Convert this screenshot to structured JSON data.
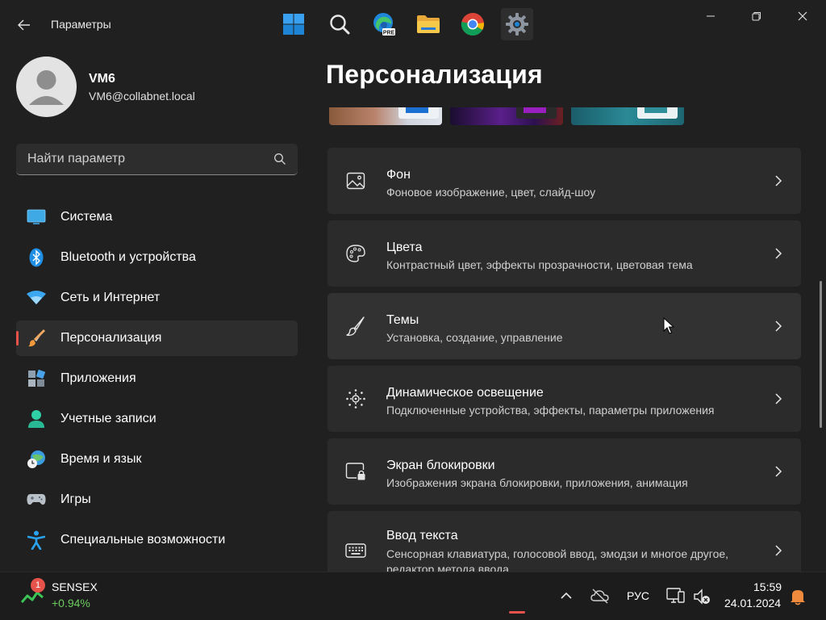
{
  "window": {
    "title": "Параметры",
    "colors": {
      "background": "#202020",
      "card": "#2b2b2b",
      "accent": "#e5534b"
    }
  },
  "profile": {
    "name": "VM6",
    "email": "VM6@collabnet.local"
  },
  "search": {
    "placeholder": "Найти параметр"
  },
  "sidebar": {
    "items": [
      {
        "label": "Система",
        "icon": "system-icon"
      },
      {
        "label": "Bluetooth и устройства",
        "icon": "bluetooth-icon"
      },
      {
        "label": "Сеть и Интернет",
        "icon": "wifi-icon"
      },
      {
        "label": "Персонализация",
        "icon": "brush-icon",
        "active": true
      },
      {
        "label": "Приложения",
        "icon": "apps-icon"
      },
      {
        "label": "Учетные записи",
        "icon": "account-icon"
      },
      {
        "label": "Время и язык",
        "icon": "time-language-icon"
      },
      {
        "label": "Игры",
        "icon": "gamepad-icon"
      },
      {
        "label": "Специальные возможности",
        "icon": "accessibility-icon"
      }
    ]
  },
  "main": {
    "title": "Персонализация",
    "cards": [
      {
        "title": "Фон",
        "subtitle": "Фоновое изображение, цвет, слайд-шоу",
        "icon": "image-icon"
      },
      {
        "title": "Цвета",
        "subtitle": "Контрастный цвет, эффекты прозрачности, цветовая тема",
        "icon": "palette-icon"
      },
      {
        "title": "Темы",
        "subtitle": "Установка, создание, управление",
        "icon": "brush-icon"
      },
      {
        "title": "Динамическое освещение",
        "subtitle": "Подключенные устройства, эффекты, параметры приложения",
        "icon": "lighting-icon"
      },
      {
        "title": "Экран блокировки",
        "subtitle": "Изображения экрана блокировки, приложения, анимация",
        "icon": "lock-screen-icon"
      },
      {
        "title": "Ввод текста",
        "subtitle": "Сенсорная клавиатура, голосовой ввод, эмодзи и многое другое, редактор метода ввода",
        "icon": "keyboard-icon"
      }
    ]
  },
  "taskbar": {
    "widget": {
      "name": "SENSEX",
      "value": "+0.94%",
      "badge": "1"
    },
    "language": "РУС",
    "time": "15:59",
    "date": "24.01.2024"
  }
}
